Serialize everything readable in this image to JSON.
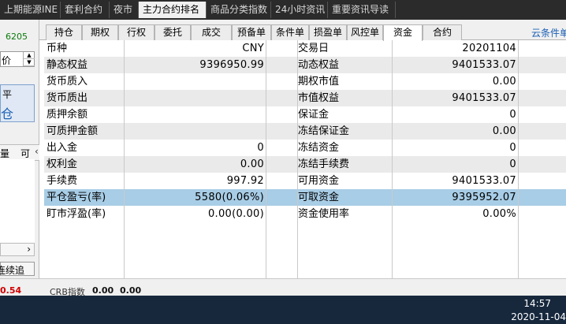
{
  "top_tabs": [
    {
      "label": "上期能源INE"
    },
    {
      "label": "套利合约"
    },
    {
      "label": "夜市"
    },
    {
      "label": "主力合约排名"
    },
    {
      "label": "商品分类指数"
    },
    {
      "label": "24小时资讯"
    },
    {
      "label": "重要资讯导读"
    }
  ],
  "left_panel": {
    "code": "6205",
    "select_value": "价",
    "button_top": "平",
    "button_bottom": "仓",
    "header_left": "量",
    "header_right": "可",
    "action_button": "连续追"
  },
  "sub_tabs": [
    {
      "label": "持仓"
    },
    {
      "label": "期权"
    },
    {
      "label": "行权"
    },
    {
      "label": "委托"
    },
    {
      "label": "成交"
    },
    {
      "label": "预备单"
    },
    {
      "label": "条件单"
    },
    {
      "label": "损盈单"
    },
    {
      "label": "风控单"
    },
    {
      "label": "资金"
    },
    {
      "label": "合约"
    }
  ],
  "cloud_link": "云条件单",
  "funds": [
    {
      "l1": "币种",
      "v1": "CNY",
      "l2": "交易日",
      "v2": "20201104"
    },
    {
      "l1": "静态权益",
      "v1": "9396950.99",
      "l2": "动态权益",
      "v2": "9401533.07"
    },
    {
      "l1": "货币质入",
      "v1": "",
      "l2": "期权市值",
      "v2": "0.00"
    },
    {
      "l1": "货币质出",
      "v1": "",
      "l2": "市值权益",
      "v2": "9401533.07"
    },
    {
      "l1": "质押余额",
      "v1": "",
      "l2": "保证金",
      "v2": "0"
    },
    {
      "l1": "可质押金额",
      "v1": "",
      "l2": "冻结保证金",
      "v2": "0.00"
    },
    {
      "l1": "出入金",
      "v1": "0",
      "l2": "冻结资金",
      "v2": "0"
    },
    {
      "l1": "权利金",
      "v1": "0.00",
      "l2": "冻结手续费",
      "v2": "0"
    },
    {
      "l1": "手续费",
      "v1": "997.92",
      "l2": "可用资金",
      "v2": "9401533.07"
    },
    {
      "l1": "平仓盈亏(率)",
      "v1": "5580(0.06%)",
      "l2": "可取资金",
      "v2": "9395952.07"
    },
    {
      "l1": "盯市浮盈(率)",
      "v1": "0.00(0.00)",
      "l2": "资金使用率",
      "v2": "0.00%"
    }
  ],
  "status_bar": {
    "red_value": "0.54",
    "index_label": "CRB指数",
    "index_value1": "0.00",
    "index_value2": "0.00"
  },
  "taskbar": {
    "time": "14:57",
    "date": "2020-11-04"
  },
  "colors": {
    "highlight_row": "#a8cde6",
    "taskbar": "#17283d",
    "link": "#1a5fb4",
    "negative": "#d00000"
  }
}
